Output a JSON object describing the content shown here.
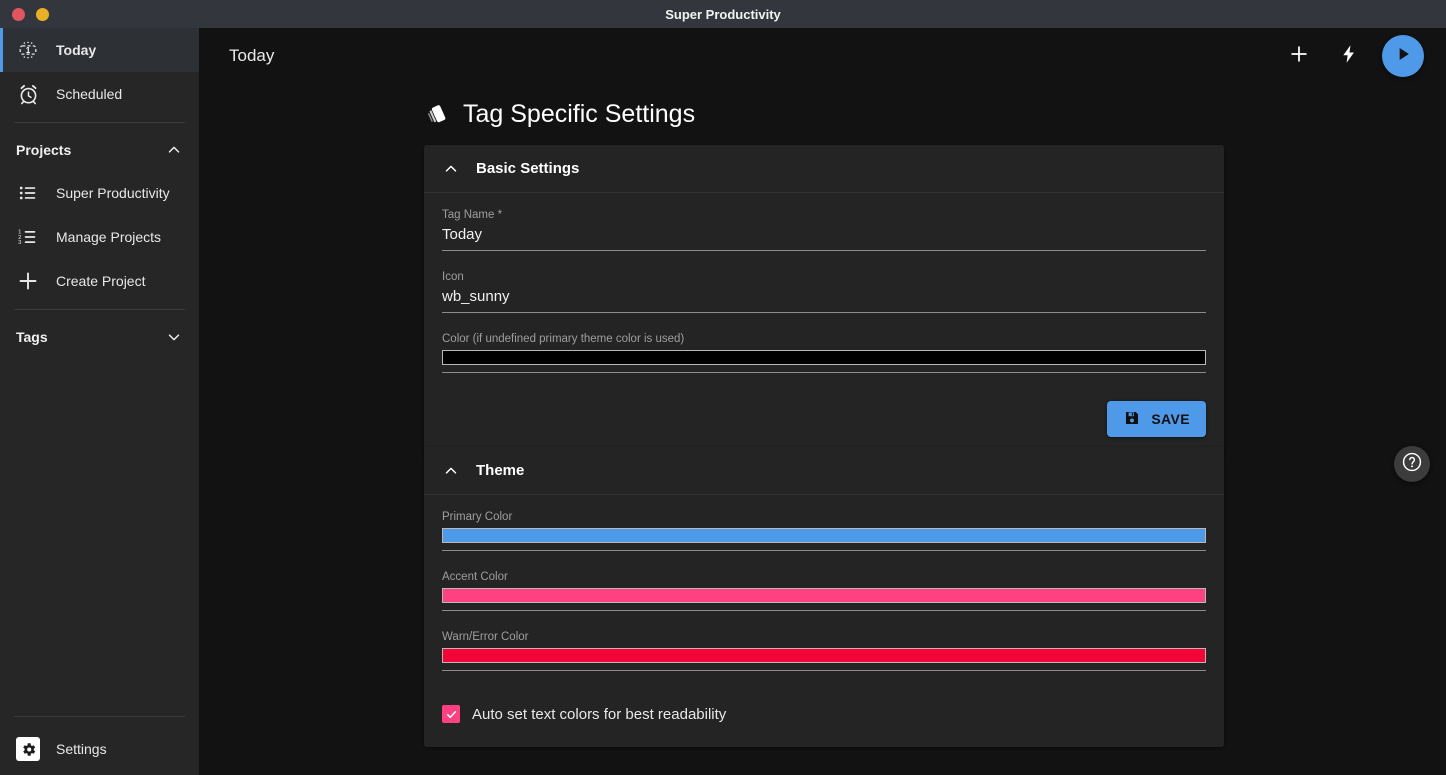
{
  "window": {
    "title": "Super Productivity",
    "controls": [
      {
        "name": "close",
        "color": "#e0555f"
      },
      {
        "name": "minimize",
        "color": "#e8b024"
      }
    ]
  },
  "sidebar": {
    "nav": [
      {
        "label": "Today",
        "icon": "today-icon",
        "active": true
      },
      {
        "label": "Scheduled",
        "icon": "alarm-clock-icon",
        "active": false
      }
    ],
    "projects_section": {
      "label": "Projects",
      "icon": "chevron-up-icon",
      "expanded": true
    },
    "projects": [
      {
        "label": "Super Productivity",
        "icon": "list-icon"
      },
      {
        "label": "Manage Projects",
        "icon": "ordered-list-icon"
      },
      {
        "label": "Create Project",
        "icon": "plus-icon"
      }
    ],
    "tags_section": {
      "label": "Tags",
      "icon": "chevron-down-icon",
      "expanded": false
    },
    "settings": {
      "label": "Settings",
      "icon": "gear-icon"
    }
  },
  "topbar": {
    "title": "Today",
    "actions": [
      {
        "name": "add-task-button",
        "icon": "plus-icon"
      },
      {
        "name": "quick-action-button",
        "icon": "lightning-bolt-icon"
      },
      {
        "name": "play-button",
        "icon": "play-icon",
        "color": "#4f9ae8"
      }
    ]
  },
  "page": {
    "title": "Tag Specific Settings",
    "title_icon": "tag-style-icon"
  },
  "basic_settings": {
    "header": "Basic Settings",
    "collapse_icon": "chevron-up-icon",
    "fields": [
      {
        "label": "Tag Name *",
        "value": "Today",
        "type": "text"
      },
      {
        "label": "Icon",
        "value": "wb_sunny",
        "type": "text"
      },
      {
        "label": "Color (if undefined primary theme color is used)",
        "value": "#000000",
        "type": "color"
      }
    ],
    "save_label": "SAVE",
    "save_icon": "save-floppy-icon"
  },
  "theme": {
    "header": "Theme",
    "collapse_icon": "chevron-up-icon",
    "colors": [
      {
        "label": "Primary Color",
        "value": "#4f9ae8"
      },
      {
        "label": "Accent Color",
        "value": "#ff4081"
      },
      {
        "label": "Warn/Error Color",
        "value": "#f50537"
      }
    ],
    "auto_text_colors": {
      "label": "Auto set text colors for best readability",
      "checked": true,
      "check_color": "#ff4081"
    }
  },
  "help": {
    "name": "help-button",
    "icon": "help-circle-icon"
  }
}
